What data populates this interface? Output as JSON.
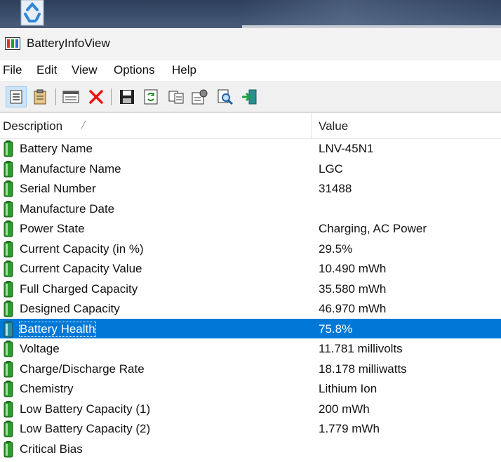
{
  "window": {
    "title": "BatteryInfoView"
  },
  "menu": [
    "File",
    "Edit",
    "View",
    "Options",
    "Help"
  ],
  "toolbar": [
    {
      "icon": "html-report-icon"
    },
    {
      "icon": "clipboard-icon"
    },
    {
      "icon": "window-icon"
    },
    {
      "icon": "delete-x-icon"
    },
    {
      "icon": "save-icon"
    },
    {
      "icon": "refresh-icon"
    },
    {
      "icon": "copy-icon"
    },
    {
      "icon": "properties-icon"
    },
    {
      "icon": "find-icon"
    },
    {
      "icon": "exit-icon"
    }
  ],
  "columns": {
    "description": "Description",
    "value": "Value"
  },
  "rows": [
    {
      "description": "Battery Name",
      "value": "LNV-45N1"
    },
    {
      "description": "Manufacture Name",
      "value": "LGC"
    },
    {
      "description": "Serial Number",
      "value": "31488"
    },
    {
      "description": "Manufacture Date",
      "value": ""
    },
    {
      "description": "Power State",
      "value": "Charging, AC Power"
    },
    {
      "description": "Current Capacity (in %)",
      "value": "29.5%"
    },
    {
      "description": "Current Capacity Value",
      "value": "10.490 mWh"
    },
    {
      "description": "Full Charged Capacity",
      "value": "35.580 mWh"
    },
    {
      "description": "Designed Capacity",
      "value": "46.970 mWh"
    },
    {
      "description": "Battery Health",
      "value": "75.8%",
      "selected": true
    },
    {
      "description": "Voltage",
      "value": "11.781 millivolts"
    },
    {
      "description": "Charge/Discharge Rate",
      "value": "18.178 milliwatts"
    },
    {
      "description": "Chemistry",
      "value": "Lithium Ion"
    },
    {
      "description": "Low Battery Capacity (1)",
      "value": "200 mWh"
    },
    {
      "description": "Low Battery Capacity (2)",
      "value": "1.779 mWh"
    },
    {
      "description": "Critical Bias",
      "value": ""
    }
  ],
  "colors": {
    "selection": "#0078d7",
    "battery_green": "#2e9b2e"
  }
}
